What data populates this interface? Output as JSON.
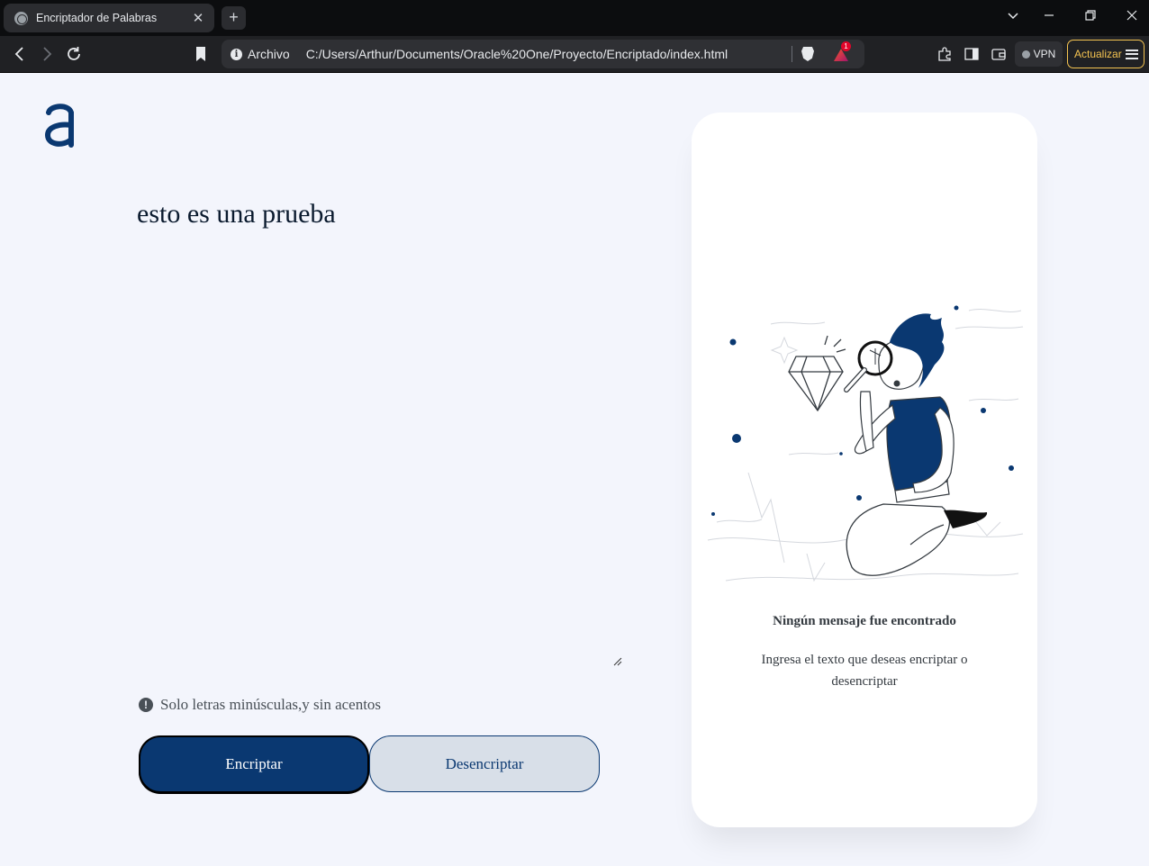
{
  "browser": {
    "tab_title": "Encriptador de Palabras",
    "tab_close": "✕",
    "new_tab": "+",
    "omnibox_label": "Archivo",
    "url": "C:/Users/Arthur/Documents/Oracle%20One/Proyecto/Encriptado/index.html",
    "rewards_badge": "1",
    "vpn_label": "VPN",
    "update_label": "Actualizar",
    "icons": [
      "globe-icon",
      "back-icon",
      "forward-icon",
      "reload-icon",
      "bookmark-icon",
      "brave-shields-icon",
      "rewards-icon",
      "extensions-icon",
      "sidebar-icon",
      "wallet-icon",
      "menu-icon"
    ]
  },
  "app": {
    "input_text": "esto es una prueba",
    "hint": "Solo letras minúsculas,y sin acentos",
    "encrypt_label": "Encriptar",
    "decrypt_label": "Desencriptar",
    "panel_title": "Ningún mensaje fue encontrado",
    "panel_subtitle": "Ingresa el texto que deseas encriptar o desencriptar",
    "colors": {
      "primary": "#0a3871",
      "background": "#f3f5fc",
      "secondary_button": "#d8dfe8",
      "update_accent": "#f5c451"
    }
  }
}
